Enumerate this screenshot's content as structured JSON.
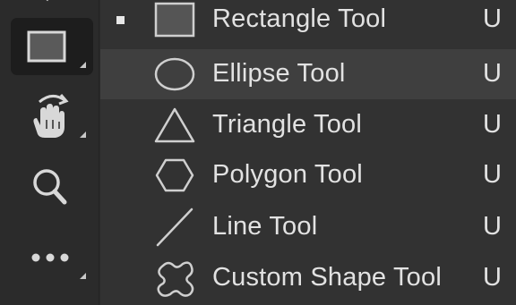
{
  "toolbar": {
    "tools": [
      {
        "icon": "rectangle-tool-icon",
        "active": true,
        "has_flyout": true
      },
      {
        "icon": "rotate-view-hand-icon",
        "active": false,
        "has_flyout": true
      },
      {
        "icon": "zoom-magnifier-icon",
        "active": false,
        "has_flyout": false
      },
      {
        "icon": "more-ellipsis-icon",
        "active": false,
        "has_flyout": true
      }
    ]
  },
  "menu": {
    "items": [
      {
        "label": "Rectangle Tool",
        "shortcut": "U",
        "icon": "rectangle-icon",
        "checked": true,
        "hovered": false
      },
      {
        "label": "Ellipse Tool",
        "shortcut": "U",
        "icon": "ellipse-icon",
        "checked": false,
        "hovered": true
      },
      {
        "label": "Triangle Tool",
        "shortcut": "U",
        "icon": "triangle-icon",
        "checked": false,
        "hovered": false
      },
      {
        "label": "Polygon Tool",
        "shortcut": "U",
        "icon": "polygon-icon",
        "checked": false,
        "hovered": false
      },
      {
        "label": "Line Tool",
        "shortcut": "U",
        "icon": "line-icon",
        "checked": false,
        "hovered": false
      },
      {
        "label": "Custom Shape Tool",
        "shortcut": "U",
        "icon": "custom-shape-icon",
        "checked": false,
        "hovered": false
      }
    ]
  },
  "colors": {
    "toolbar_bg": "#2b2b2b",
    "menu_bg": "#323232",
    "hover_bg": "#3f3f3f",
    "active_tool_bg": "#1d1d1d",
    "text": "#e2e2e2",
    "icon": "#cfcfcf"
  }
}
